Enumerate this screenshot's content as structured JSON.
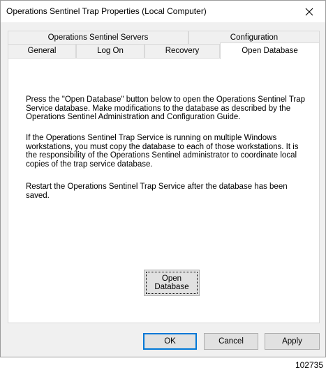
{
  "window": {
    "title": "Operations Sentinel Trap Properties (Local Computer)"
  },
  "tabs": {
    "row_back": [
      {
        "label": "Operations Sentinel Servers"
      },
      {
        "label": "Configuration"
      }
    ],
    "row_front": [
      {
        "label": "General"
      },
      {
        "label": "Log On"
      },
      {
        "label": "Recovery"
      },
      {
        "label": "Open Database",
        "selected": true
      }
    ]
  },
  "panel": {
    "paragraphs": [
      "Press the \"Open Database\" button below to open the Operations Sentinel Trap Service database.  Make modifications to the database as described by the Operations Sentinel Administration and Configuration Guide.",
      "If the Operations Sentinel Trap Service is running on multiple Windows workstations, you must copy the database to each of those workstations.  It is the responsibility of the Operations Sentinel administrator to coordinate local copies of the trap service database.",
      "Restart the Operations Sentinel Trap Service after the database has been saved."
    ],
    "open_db_button": {
      "line1": "Open",
      "line2": "Database"
    }
  },
  "buttons": {
    "ok": "OK",
    "cancel": "Cancel",
    "apply": "Apply"
  },
  "figure_id": "102735",
  "icons": {
    "close": "close-icon"
  },
  "colors": {
    "focus_border": "#0078d7",
    "button_face": "#e1e1e1",
    "dialog_bg": "#f0f0f0"
  }
}
